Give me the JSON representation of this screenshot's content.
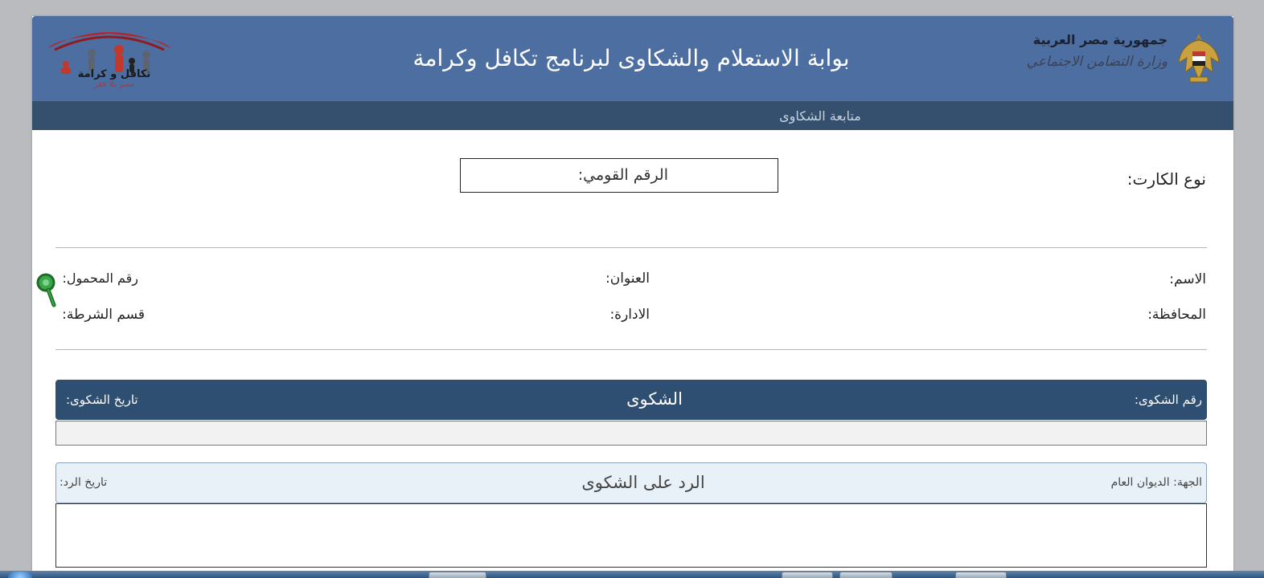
{
  "colors": {
    "header_bg": "#4d6ea1",
    "subnav_bg": "#35506f",
    "complaint_bar_bg": "#2f4f72",
    "reply_bar_bg": "#e9f1f8"
  },
  "header": {
    "title": "بوابة الاستعلام والشكاوى لبرنامج تكافل وكرامة",
    "ministry_country": "جمهورية مصر العربية",
    "ministry_name": "وزارة التضامن الاجتماعي",
    "emblem_icon": "egypt-eagle-emblem-icon",
    "program_logo_text": "تكافل و كرامة",
    "program_logo_subtext": "مصر بلا فقر"
  },
  "subnav": {
    "item": "متابعة الشكاوى"
  },
  "search": {
    "card_type_label": "نوع الكارت:",
    "national_id_label": "الرقم القومي:"
  },
  "info": {
    "name_label": "الاسم:",
    "address_label": "العنوان:",
    "mobile_label": "رقم المحمول:",
    "governorate_label": "المحافظة:",
    "department_label": "الادارة:",
    "police_station_label": "قسم الشرطة:"
  },
  "complaint": {
    "number_label": "رقم الشكوى:",
    "title": "الشكوى",
    "date_label": "تاريخ الشكوى:"
  },
  "reply": {
    "entity_label": "الجهة:",
    "entity_value": "الديوان العام",
    "title": "الرد على الشكوى",
    "date_label": "تاريخ الرد:"
  }
}
